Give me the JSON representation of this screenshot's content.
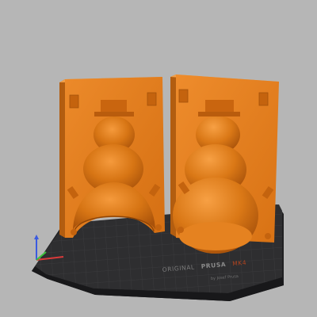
{
  "viewport": {
    "background_color": "#b6b6b6",
    "model_color": "#e07a1c",
    "bed_color": "#2e2e30"
  },
  "bed": {
    "brand_light": "ORIGINAL",
    "brand_bold": "PRUSA",
    "model": "MK4",
    "maker": "by Josef Prusa"
  },
  "axes": {
    "x_color": "#d93a3a",
    "y_color": "#3ac23a",
    "z_color": "#3a5ae0"
  },
  "objects": [
    {
      "name": "snowman-mold-half-left"
    },
    {
      "name": "snowman-mold-half-right"
    }
  ]
}
